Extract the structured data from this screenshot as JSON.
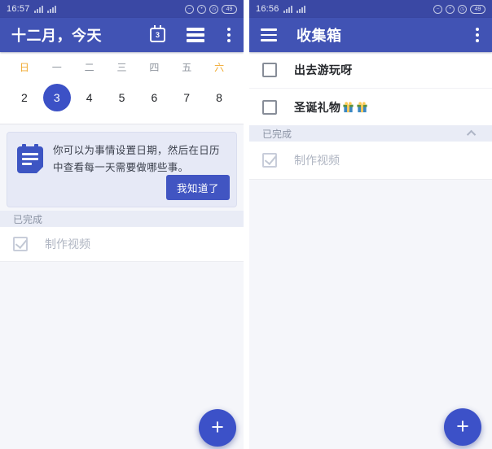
{
  "colors": {
    "status_bar": "#3A48A4",
    "toolbar": "#4153B4",
    "accent_blue": "#3C51C6",
    "weekend_amber": "#F0A92E",
    "tip_card_bg": "#E6E9F6",
    "section_bg": "#E9ECF6",
    "content_bg": "#F5F6FA",
    "done_text": "#AFB5C2"
  },
  "left": {
    "status_bar": {
      "time": "16:57",
      "battery": "49"
    },
    "toolbar": {
      "title": "十二月，今天",
      "calendar_badge": "3"
    },
    "week": {
      "day_names": [
        "日",
        "一",
        "二",
        "三",
        "四",
        "五",
        "六"
      ],
      "dates": [
        "2",
        "3",
        "4",
        "5",
        "6",
        "7",
        "8"
      ],
      "selected_date": "3",
      "weekend_day_names": [
        "日",
        "六"
      ]
    },
    "tip_card": {
      "text": "你可以为事情设置日期，然后在日历中查看每一天需要做哪些事。",
      "button_label": "我知道了"
    },
    "completed_section": {
      "header": "已完成",
      "items": [
        {
          "title": "制作视频",
          "checked": true
        }
      ]
    },
    "fab_label": "+"
  },
  "right": {
    "status_bar": {
      "time": "16:56",
      "battery": "49"
    },
    "toolbar": {
      "title": "收集箱"
    },
    "items": [
      {
        "title": "出去游玩呀",
        "checked": false
      },
      {
        "title": "圣诞礼物",
        "emoji": "🎁🎁",
        "checked": false
      }
    ],
    "completed_section": {
      "header": "已完成",
      "collapse_state": "expanded",
      "items": [
        {
          "title": "制作视频",
          "checked": true
        }
      ]
    },
    "fab_label": "+"
  }
}
